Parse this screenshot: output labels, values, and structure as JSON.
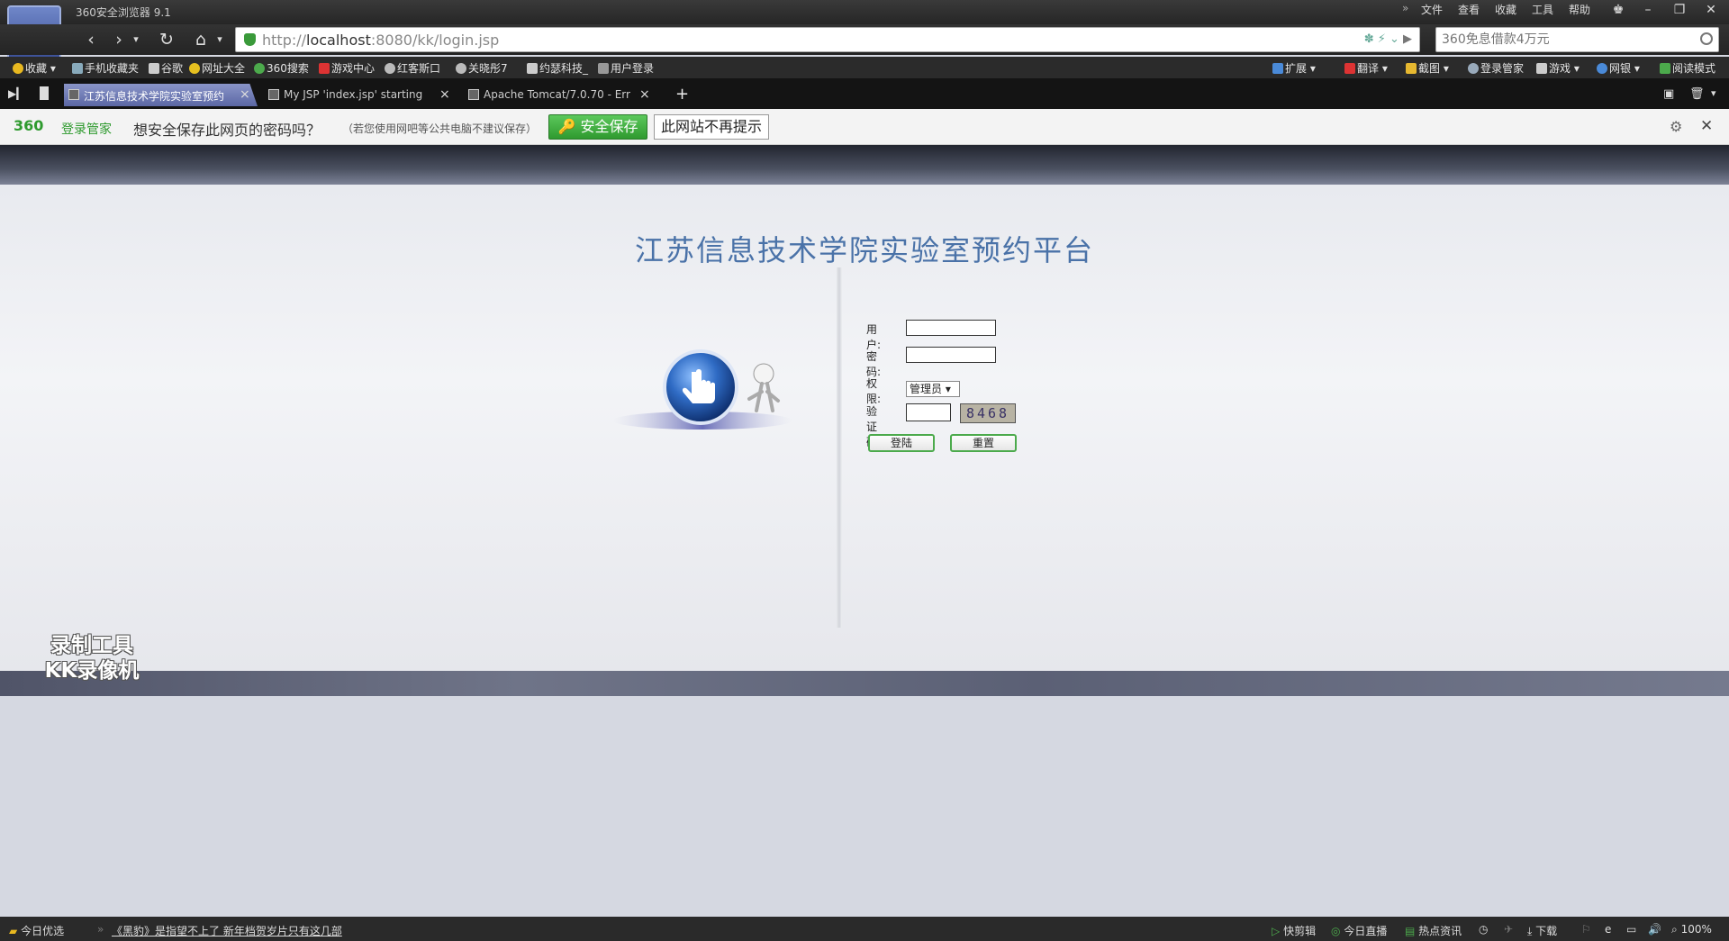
{
  "browser": {
    "title": "360安全浏览器 9.1",
    "menu": [
      "文件",
      "查看",
      "收藏",
      "工具",
      "帮助"
    ],
    "address": {
      "host": "localhost",
      "prefix": "http://",
      "suffix": ":8080/kk/login.jsp"
    },
    "search_placeholder": "360免息借款4万元",
    "bookmarks": [
      "收藏",
      "手机收藏夹",
      "谷歌",
      "网址大全",
      "360搜索",
      "游戏中心",
      "红客斯口",
      "关晓彤7",
      "约瑟科技_",
      "用户登录"
    ],
    "right_tools": [
      "扩展",
      "翻译",
      "截图",
      "登录管家",
      "游戏",
      "网银",
      "阅读模式"
    ],
    "tabs": [
      {
        "label": "江苏信息技术学院实验室预约",
        "active": true
      },
      {
        "label": "My JSP 'index.jsp' starting",
        "active": false
      },
      {
        "label": "Apache Tomcat/7.0.70 - Err",
        "active": false
      }
    ],
    "new_tab": "+"
  },
  "password_bar": {
    "brand": "360",
    "brand_text": "登录管家",
    "question": "想安全保存此网页的密码吗？",
    "note": "（若您使用网吧等公共电脑不建议保存）",
    "save_label": "安全保存",
    "never_label": "此网站不再提示"
  },
  "page": {
    "title": "江苏信息技术学院实验室预约平台",
    "form": {
      "user_label": "用户:",
      "password_label": "密码:",
      "role_label": "权限:",
      "role_value": "管理员",
      "captcha_label": "验证码:",
      "captcha_value": "8468",
      "login_label": "登陆",
      "reset_label": "重置"
    }
  },
  "watermark": [
    "录制工具",
    "KK录像机"
  ],
  "statusbar": {
    "left_label": "今日优选",
    "news": "《黑豹》是指望不上了 新年档贺岁片只有这几部",
    "right_items": [
      "快剪辑",
      "今日直播",
      "热点资讯",
      "下载"
    ],
    "zoom": "100%"
  }
}
